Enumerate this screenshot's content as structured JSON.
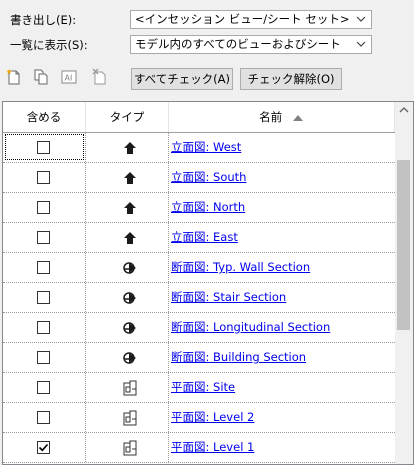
{
  "export": {
    "label": "書き出し(E):",
    "value": "<インセッション ビュー/シート セット>"
  },
  "display": {
    "label": "一覧に表示(S):",
    "value": "モデル内のすべてのビューおよびシート"
  },
  "toolbar": {
    "icons": [
      "new-set-icon",
      "duplicate-icon",
      "rename-icon",
      "delete-icon"
    ],
    "check_all_label": "すべてチェック(A)",
    "uncheck_all_label": "チェック解除(O)"
  },
  "table": {
    "headers": {
      "include": "含める",
      "type": "タイプ",
      "name": "名前"
    },
    "sort": "ascending",
    "rows": [
      {
        "checked": false,
        "type": "elevation",
        "name": "立面図: West"
      },
      {
        "checked": false,
        "type": "elevation",
        "name": "立面図: South"
      },
      {
        "checked": false,
        "type": "elevation",
        "name": "立面図: North"
      },
      {
        "checked": false,
        "type": "elevation",
        "name": "立面図: East"
      },
      {
        "checked": false,
        "type": "section",
        "name": "断面図: Typ. Wall Section"
      },
      {
        "checked": false,
        "type": "section",
        "name": "断面図: Stair Section"
      },
      {
        "checked": false,
        "type": "section",
        "name": "断面図: Longitudinal Section"
      },
      {
        "checked": false,
        "type": "section",
        "name": "断面図: Building Section"
      },
      {
        "checked": false,
        "type": "plan",
        "name": "平面図: Site"
      },
      {
        "checked": false,
        "type": "plan",
        "name": "平面図: Level 2"
      },
      {
        "checked": true,
        "type": "plan",
        "name": "平面図: Level 1"
      }
    ]
  }
}
